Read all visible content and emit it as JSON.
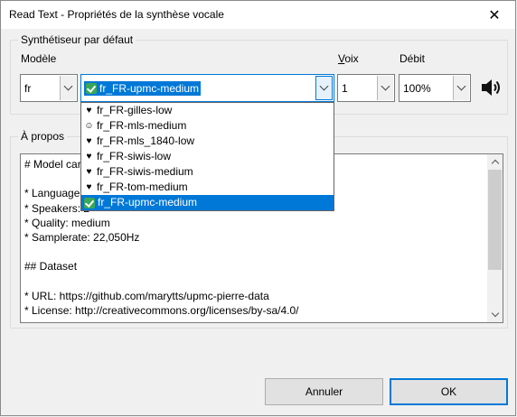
{
  "window": {
    "title": "Read Text - Propriétés de la synthèse vocale",
    "close_glyph": "✕"
  },
  "synth_group": {
    "legend": "Synthétiseur par défaut",
    "model_label": "Modèle",
    "voice_label_accel": "V",
    "voice_label_rest": "oix",
    "rate_label": "Débit",
    "language_value": "fr",
    "model_value": "fr_FR-upmc-medium",
    "voice_value": "1",
    "rate_value": "100%",
    "speaker_icon": "speaker-icon"
  },
  "model_dropdown": {
    "items": [
      {
        "label": "fr_FR-gilles-low",
        "glyph": "♥",
        "selected": false
      },
      {
        "label": "fr_FR-mls-medium",
        "glyph": "☺",
        "selected": false
      },
      {
        "label": "fr_FR-mls_1840-low",
        "glyph": "♥",
        "selected": false
      },
      {
        "label": "fr_FR-siwis-low",
        "glyph": "♥",
        "selected": false
      },
      {
        "label": "fr_FR-siwis-medium",
        "glyph": "♥",
        "selected": false
      },
      {
        "label": "fr_FR-tom-medium",
        "glyph": "♥",
        "selected": false
      },
      {
        "label": "fr_FR-upmc-medium",
        "glyph": "check",
        "selected": true
      }
    ]
  },
  "about_group": {
    "legend": "À propos",
    "lines": [
      "# Model car",
      "",
      "* Language:",
      "* Speakers: 2",
      "* Quality: medium",
      "* Samplerate: 22,050Hz",
      "",
      "## Dataset",
      "",
      "* URL: https://github.com/marytts/upmc-pierre-data",
      "* License: http://creativecommons.org/licenses/by-sa/4.0/"
    ]
  },
  "buttons": {
    "cancel": "Annuler",
    "ok": "OK"
  },
  "colors": {
    "accent": "#0078d7",
    "check_green": "#3aa757"
  }
}
